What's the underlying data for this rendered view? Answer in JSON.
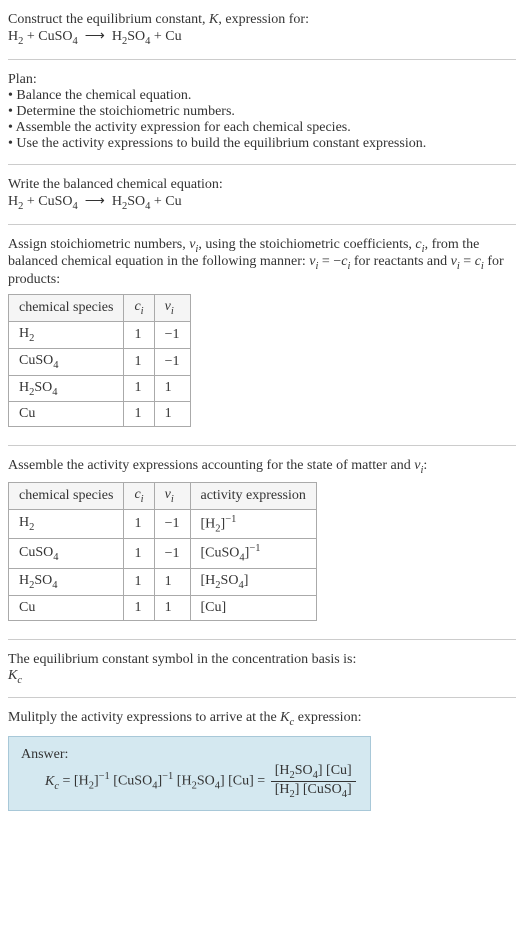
{
  "prompt": {
    "line1": "Construct the equilibrium constant, K, expression for:",
    "equation": "H₂ + CuSO₄ ⟶ H₂SO₄ + Cu"
  },
  "plan": {
    "heading": "Plan:",
    "items": [
      "Balance the chemical equation.",
      "Determine the stoichiometric numbers.",
      "Assemble the activity expression for each chemical species.",
      "Use the activity expressions to build the equilibrium constant expression."
    ]
  },
  "balanced": {
    "heading": "Write the balanced chemical equation:",
    "equation": "H₂ + CuSO₄ ⟶ H₂SO₄ + Cu"
  },
  "stoich": {
    "text1": "Assign stoichiometric numbers, νᵢ, using the stoichiometric coefficients, cᵢ, from the balanced chemical equation in the following manner: νᵢ = −cᵢ for reactants and νᵢ = cᵢ for products:",
    "headers": {
      "species": "chemical species",
      "ci": "cᵢ",
      "vi": "νᵢ"
    },
    "rows": [
      {
        "species": "H₂",
        "ci": "1",
        "vi": "−1"
      },
      {
        "species": "CuSO₄",
        "ci": "1",
        "vi": "−1"
      },
      {
        "species": "H₂SO₄",
        "ci": "1",
        "vi": "1"
      },
      {
        "species": "Cu",
        "ci": "1",
        "vi": "1"
      }
    ]
  },
  "activity": {
    "text": "Assemble the activity expressions accounting for the state of matter and νᵢ:",
    "headers": {
      "species": "chemical species",
      "ci": "cᵢ",
      "vi": "νᵢ",
      "ae": "activity expression"
    },
    "rows": [
      {
        "species": "H₂",
        "ci": "1",
        "vi": "−1",
        "ae": "[H₂]⁻¹"
      },
      {
        "species": "CuSO₄",
        "ci": "1",
        "vi": "−1",
        "ae": "[CuSO₄]⁻¹"
      },
      {
        "species": "H₂SO₄",
        "ci": "1",
        "vi": "1",
        "ae": "[H₂SO₄]"
      },
      {
        "species": "Cu",
        "ci": "1",
        "vi": "1",
        "ae": "[Cu]"
      }
    ]
  },
  "symbol": {
    "text": "The equilibrium constant symbol in the concentration basis is:",
    "val": "K_c"
  },
  "mult": {
    "text": "Mulitply the activity expressions to arrive at the K_c expression:"
  },
  "answer": {
    "label": "Answer:",
    "lhs": "K_c = [H₂]⁻¹ [CuSO₄]⁻¹ [H₂SO₄] [Cu] = ",
    "num": "[H₂SO₄] [Cu]",
    "den": "[H₂] [CuSO₄]"
  }
}
